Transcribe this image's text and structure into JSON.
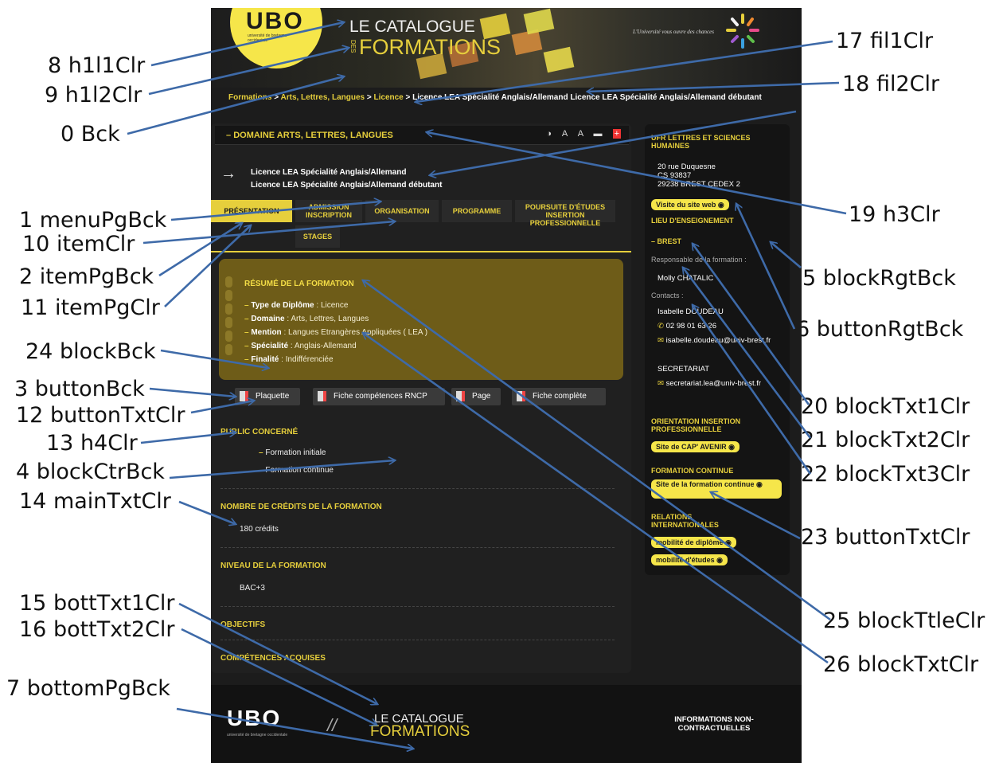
{
  "annotations": [
    "8 h1l1Clr",
    "9 h1l2Clr",
    "0 Bck",
    "1 menuPgBck",
    "10 itemClr",
    "2 itemPgBck",
    "11 itemPgClr",
    "24 blockBck",
    "3 buttonBck",
    "12 buttonTxtClr",
    "13 h4Clr",
    "4 blockCtrBck",
    "14 mainTxtClr",
    "15 bottTxt1Clr",
    "16 bottTxt2Clr",
    "7 bottomPgBck",
    "17 fil1Clr",
    "18 fil2Clr",
    "19 h3Clr",
    "5 blockRgtBck",
    "6 buttonRgtBck",
    "20 blockTxt1Clr",
    "21 blockTxt2Clr",
    "22 blockTxt3Clr",
    "23 buttonTxtClr",
    "25 blockTtleClr",
    "26 blockTxtClr"
  ],
  "header": {
    "logo": "UBO",
    "logo_sub": "université de bretagne occidentale",
    "catalogue_line1": "LE CATALOGUE",
    "catalogue_des": "DES",
    "catalogue_line2": "FORMATIONS",
    "slogan": "L'Université vous ouvre des chances"
  },
  "breadcrumb": {
    "formations": "Formations",
    "sep": ">",
    "domain": "Arts, Lettres, Langues",
    "licence": "Licence",
    "current": "Licence LEA Spécialité Anglais/Allemand Licence LEA Spécialité Anglais/Allemand débutant"
  },
  "main": {
    "domain_title": "DOMAINE ARTS, LETTRES, LANGUES",
    "tools": [
      "◑",
      "A",
      "A",
      "▬",
      "+"
    ],
    "formation_line1": "Licence LEA Spécialité Anglais/Allemand",
    "formation_line2": "Licence LEA Spécialité Anglais/Allemand débutant",
    "tabs": [
      "PRÉSENTATION",
      "ADMISSION INSCRIPTION",
      "ORGANISATION",
      "PROGRAMME",
      "POURSUITE D'ÉTUDES INSERTION PROFESSIONNELLE",
      "STAGES"
    ],
    "resume_title": "RÉSUMÉ DE LA FORMATION",
    "resume_items": [
      {
        "key": "Type de Diplôme",
        "value": " : Licence"
      },
      {
        "key": "Domaine",
        "value": " : Arts, Lettres, Langues"
      },
      {
        "key": "Mention",
        "value": " : Langues Etrangères Appliquées ( LEA )"
      },
      {
        "key": "Spécialité",
        "value": " : Anglais-Allemand"
      },
      {
        "key": "Finalité",
        "value": " : Indifférenciée"
      }
    ],
    "buttons": [
      "Plaquette",
      "Fiche compétences RNCP",
      "Page",
      "Fiche complète"
    ],
    "public_title": "PUBLIC CONCERNÉ",
    "public_items": [
      "Formation initiale",
      "Formation continue"
    ],
    "credits_title": "NOMBRE DE CRÉDITS DE LA FORMATION",
    "credits_value": "180 crédits",
    "niveau_title": "NIVEAU DE LA FORMATION",
    "niveau_value": "BAC+3",
    "objectifs_title": "OBJECTIFS",
    "competences_title": "COMPÉTENCES ACQUISES"
  },
  "right": {
    "ufr_title": "UFR LETTRES ET SCIENCES HUMAINES",
    "addr1": "20 rue Duquesne",
    "addr2": "CS 93837",
    "addr3": "29238 BREST CEDEX 2",
    "site_btn": "Visite du site web",
    "lieu_title": "LIEU D'ENSEIGNEMENT",
    "lieu_value": "BREST",
    "resp_label": "Responsable de la formation :",
    "resp_name": "Molly CHATALIC",
    "contacts_label": "Contacts :",
    "contact_name": "Isabelle DOUDEAU",
    "contact_phone": "02 98 01 63 26",
    "contact_email": "isabelle.doudeau@univ-brest.fr",
    "secretariat": "SECRETARIAT",
    "secretariat_email": "secretariat.lea@univ-brest.fr",
    "orientation_title": "ORIENTATION INSERTION PROFESSIONNELLE",
    "orientation_btn": "Site de CAP' AVENIR",
    "fc_title": "FORMATION CONTINUE",
    "fc_btn": "Site de la formation continue",
    "ri_title": "RELATIONS INTERNATIONALES",
    "ri_btn1": "mobilité de diplôme",
    "ri_btn2": "mobilité d'études"
  },
  "footer": {
    "logo": "UBO",
    "logo_sub": "université de bretagne occidentale",
    "slash": "//",
    "catalogue_line1": "LE CATALOGUE",
    "catalogue_line2": "FORMATIONS",
    "info": "INFORMATIONS NON-CONTRACTUELLES"
  },
  "colors": {
    "accent_yellow": "#e6cf3c",
    "arrow_blue": "#3e6aa8",
    "panel_dark": "#1c1c1c",
    "resume_bg": "#6e5c18"
  }
}
